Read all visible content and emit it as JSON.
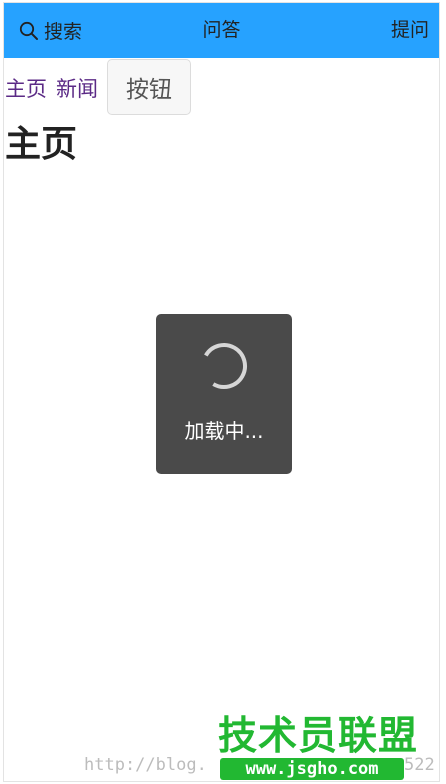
{
  "header": {
    "search_label": "搜索",
    "title": "问答",
    "ask_label": "提问",
    "background_color": "#26a2ff"
  },
  "nav": {
    "home_link": "主页",
    "news_link": "新闻",
    "button_label": "按钮",
    "link_color": "#5b2a86"
  },
  "page": {
    "title": "主页"
  },
  "loading_toast": {
    "text": "加载中...",
    "icon": "spinner-icon",
    "background_color": "#4a4a4a"
  },
  "watermark": {
    "logo_text": "技术员联盟",
    "url_text": "http://blog.",
    "url_tail": "522",
    "site_text": "www.jsgho.com",
    "color": "#22b832"
  }
}
